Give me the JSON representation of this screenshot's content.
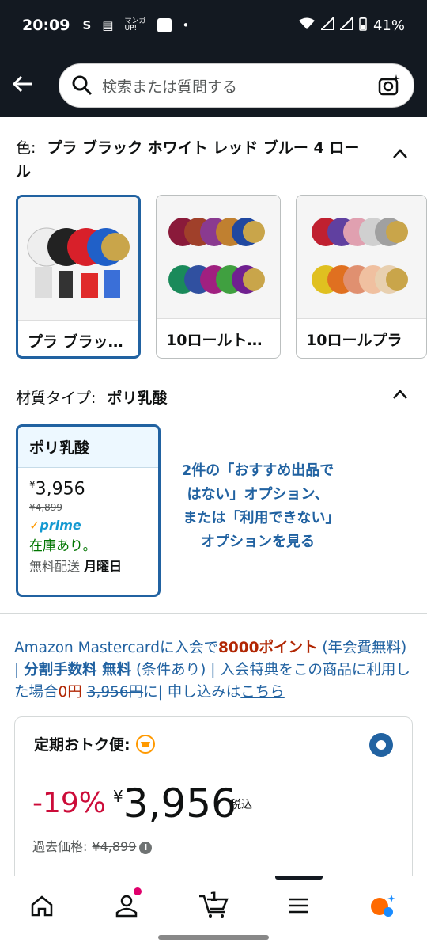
{
  "status": {
    "time": "20:09",
    "battery": "41%",
    "icons": [
      "s-icon",
      "news-icon",
      "manga-icon",
      "amazon-icon",
      "dot-icon"
    ]
  },
  "search": {
    "placeholder": "検索または質問する"
  },
  "color_section": {
    "label": "色:",
    "value": "プラ ブラック ホワイト レッド ブルー 4 ロール"
  },
  "swatches": [
    {
      "label": "プラ ブラッ…",
      "selected": true
    },
    {
      "label": "10ロールト…",
      "selected": false
    },
    {
      "label": "10ロールプラ",
      "selected": false
    }
  ],
  "material_section": {
    "label": "材質タイプ:",
    "value": "ポリ乳酸"
  },
  "material_card": {
    "title": "ポリ乳酸",
    "currency": "¥",
    "price": "3,956",
    "old_price": "¥4,899",
    "prime": "prime",
    "stock": "在庫あり。",
    "ship_label": "無料配送",
    "ship_day": "月曜日"
  },
  "other_options": "2件の「おすすめ出品ではない」オプション、または「利用できない」オプションを見る",
  "promo": {
    "p1": "Amazon Mastercardに入会で",
    "p2": "8000ポイント",
    "p3": " (年会費無料) | ",
    "p4": "分割手数料 無料",
    "p5": " (条件あり) | 入会特典をこの商品に利用した場合",
    "p6": "0円",
    "p7": " ",
    "p8": "3,956円",
    "p9": "に| 申し込みは",
    "p10": "こちら"
  },
  "subscription": {
    "title": "定期おトク便:",
    "discount": "-19%",
    "currency": "¥",
    "price": "3,956",
    "tax": "税込",
    "past_label": "過去価格:",
    "past_price": "¥4,899"
  },
  "nav": {
    "cart_count": "1"
  },
  "colors": {
    "brand_dark": "#131921",
    "link": "#2162a1",
    "discount": "#cc0c39",
    "stock": "#007600"
  }
}
